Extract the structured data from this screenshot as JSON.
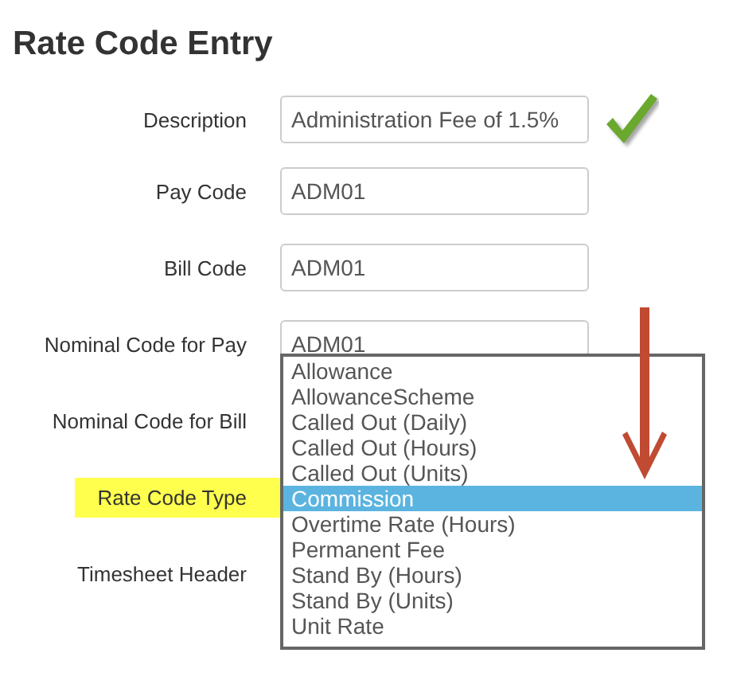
{
  "title": "Rate Code Entry",
  "fields": [
    {
      "label": "Description",
      "kind": "input",
      "value": "Administration Fee of 1.5%",
      "highlighted": false,
      "valid": true
    },
    {
      "label": "Pay Code",
      "kind": "input",
      "value": "ADM01",
      "highlighted": false,
      "valid": false
    },
    {
      "label": "Bill Code",
      "kind": "input",
      "value": "ADM01",
      "highlighted": false,
      "valid": false
    },
    {
      "label": "Nominal Code for Pay",
      "kind": "input",
      "value": "ADM01",
      "highlighted": false,
      "valid": false
    },
    {
      "label": "Nominal Code for Bill",
      "kind": "covered",
      "highlighted": false,
      "valid": false
    },
    {
      "label": "Rate Code Type",
      "kind": "covered",
      "highlighted": true,
      "valid": false
    },
    {
      "label": "Timesheet Header",
      "kind": "covered",
      "highlighted": false,
      "valid": false
    }
  ],
  "dropdown": {
    "options": [
      {
        "label": "Allowance",
        "selected": false
      },
      {
        "label": "AllowanceScheme",
        "selected": false
      },
      {
        "label": "Called Out (Daily)",
        "selected": false
      },
      {
        "label": "Called Out (Hours)",
        "selected": false
      },
      {
        "label": "Called Out (Units)",
        "selected": false
      },
      {
        "label": "Commission",
        "selected": true
      },
      {
        "label": "Overtime Rate (Hours)",
        "selected": false
      },
      {
        "label": "Permanent Fee",
        "selected": false
      },
      {
        "label": "Stand By (Hours)",
        "selected": false
      },
      {
        "label": "Stand By (Units)",
        "selected": false
      },
      {
        "label": "Unit Rate",
        "selected": false
      }
    ]
  }
}
